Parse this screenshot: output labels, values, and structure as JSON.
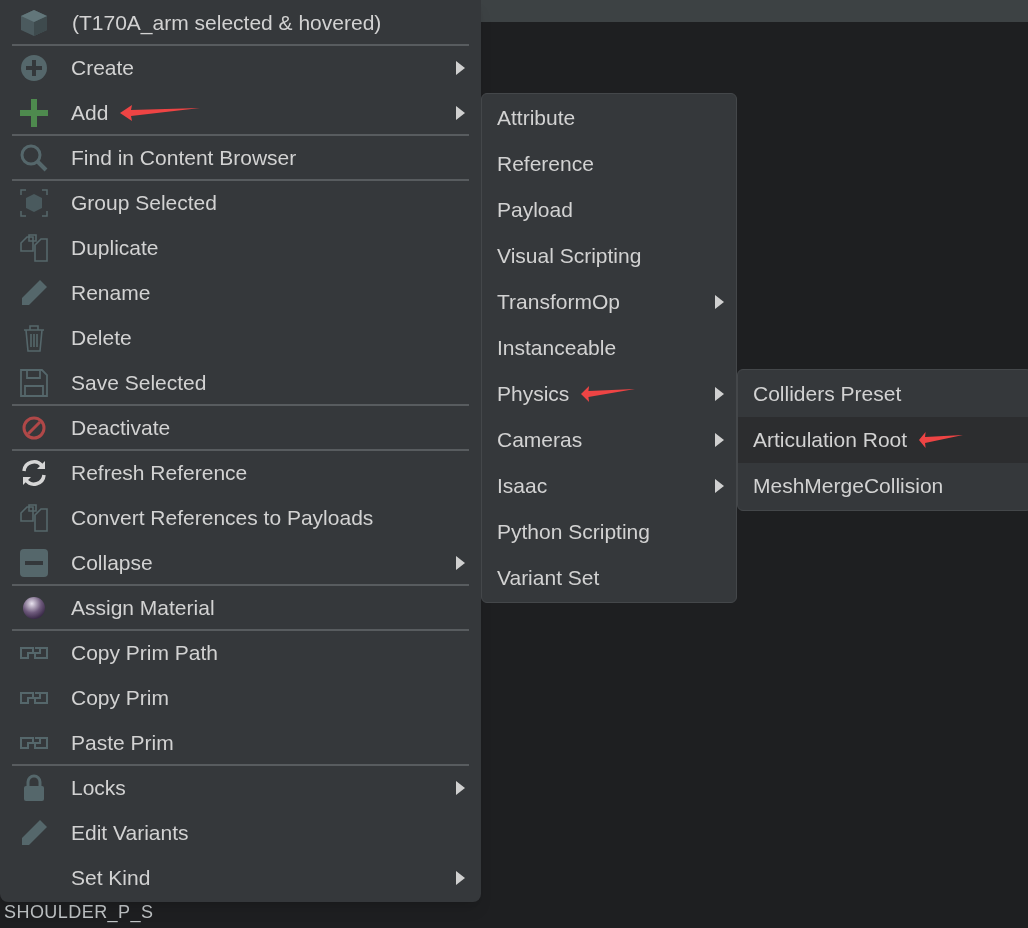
{
  "header": {
    "label": "(T170A_arm selected & hovered)"
  },
  "menu": [
    {
      "label": "Create",
      "submenu": true,
      "separator_after": false,
      "annotated": false
    },
    {
      "label": "Add",
      "submenu": true,
      "separator_after": true,
      "annotated": true
    },
    {
      "label": "Find in Content Browser",
      "submenu": false,
      "separator_after": true,
      "annotated": false
    },
    {
      "label": "Group Selected",
      "submenu": false,
      "separator_after": false,
      "annotated": false
    },
    {
      "label": "Duplicate",
      "submenu": false,
      "separator_after": false,
      "annotated": false
    },
    {
      "label": "Rename",
      "submenu": false,
      "separator_after": false,
      "annotated": false
    },
    {
      "label": "Delete",
      "submenu": false,
      "separator_after": false,
      "annotated": false
    },
    {
      "label": "Save Selected",
      "submenu": false,
      "separator_after": true,
      "annotated": false
    },
    {
      "label": "Deactivate",
      "submenu": false,
      "separator_after": true,
      "annotated": false
    },
    {
      "label": "Refresh Reference",
      "submenu": false,
      "separator_after": false,
      "annotated": false
    },
    {
      "label": "Convert References to Payloads",
      "submenu": false,
      "separator_after": false,
      "annotated": false
    },
    {
      "label": "Collapse",
      "submenu": true,
      "separator_after": true,
      "annotated": false
    },
    {
      "label": "Assign Material",
      "submenu": false,
      "separator_after": true,
      "annotated": false
    },
    {
      "label": "Copy Prim Path",
      "submenu": false,
      "separator_after": false,
      "annotated": false
    },
    {
      "label": "Copy Prim",
      "submenu": false,
      "separator_after": false,
      "annotated": false
    },
    {
      "label": "Paste Prim",
      "submenu": false,
      "separator_after": true,
      "annotated": false
    },
    {
      "label": "Locks",
      "submenu": true,
      "separator_after": false,
      "annotated": false
    },
    {
      "label": "Edit Variants",
      "submenu": false,
      "separator_after": false,
      "annotated": false
    },
    {
      "label": "Set Kind",
      "submenu": true,
      "separator_after": false,
      "annotated": false
    }
  ],
  "add_submenu": [
    {
      "label": "Attribute",
      "submenu": false,
      "annotated": false
    },
    {
      "label": "Reference",
      "submenu": false,
      "annotated": false
    },
    {
      "label": "Payload",
      "submenu": false,
      "annotated": false
    },
    {
      "label": "Visual Scripting",
      "submenu": false,
      "annotated": false
    },
    {
      "label": "TransformOp",
      "submenu": true,
      "annotated": false
    },
    {
      "label": "Instanceable",
      "submenu": false,
      "annotated": false
    },
    {
      "label": "Physics",
      "submenu": true,
      "annotated": true
    },
    {
      "label": "Cameras",
      "submenu": true,
      "annotated": false
    },
    {
      "label": "Isaac",
      "submenu": true,
      "annotated": false
    },
    {
      "label": "Python Scripting",
      "submenu": false,
      "annotated": false
    },
    {
      "label": "Variant Set",
      "submenu": false,
      "annotated": false
    }
  ],
  "physics_submenu": [
    {
      "label": "Colliders Preset",
      "selected": false,
      "annotated": false
    },
    {
      "label": "Articulation Root",
      "selected": true,
      "annotated": true
    },
    {
      "label": "MeshMergeCollision",
      "selected": false,
      "annotated": false
    }
  ],
  "tree_label": "SHOULDER_P_S"
}
